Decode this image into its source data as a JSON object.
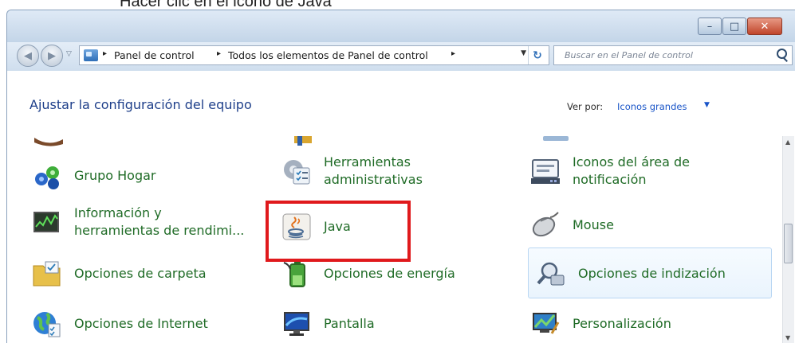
{
  "caption": "Hacer clic en el icono de Java",
  "window": {
    "controls": {
      "minimize": "–",
      "maximize": "□",
      "close": "✕"
    }
  },
  "navigation": {
    "back_icon": "◀",
    "forward_icon": "▶",
    "history_icon": "▽",
    "breadcrumb": [
      "Panel de control",
      "Todos los elementos de Panel de control"
    ],
    "separator": "▸",
    "dropdown_icon": "▼",
    "refresh_icon": "↻",
    "search_placeholder": "Buscar en el Panel de control"
  },
  "page": {
    "heading": "Ajustar la configuración del equipo",
    "view_by_label": "Ver por:",
    "view_by_value": "Iconos grandes",
    "view_by_arrow": "▼"
  },
  "items": [
    {
      "id": "grupo-hogar",
      "lines": [
        "Grupo Hogar"
      ],
      "icon": "homegroup-icon"
    },
    {
      "id": "herramientas-administrativas",
      "lines": [
        "Herramientas",
        "administrativas"
      ],
      "icon": "admin-tools-icon"
    },
    {
      "id": "iconos-area-notificacion",
      "lines": [
        "Iconos del área de",
        "notificación"
      ],
      "icon": "notification-area-icon"
    },
    {
      "id": "informacion-rendimiento",
      "lines": [
        "Información y",
        "herramientas de rendimi..."
      ],
      "icon": "performance-icon"
    },
    {
      "id": "java",
      "lines": [
        "Java"
      ],
      "icon": "java-icon",
      "highlighted": true
    },
    {
      "id": "mouse",
      "lines": [
        "Mouse"
      ],
      "icon": "mouse-icon"
    },
    {
      "id": "opciones-carpeta",
      "lines": [
        "Opciones de carpeta"
      ],
      "icon": "folder-options-icon"
    },
    {
      "id": "opciones-energia",
      "lines": [
        "Opciones de energía"
      ],
      "icon": "power-options-icon"
    },
    {
      "id": "opciones-indizacion",
      "lines": [
        "Opciones de indización"
      ],
      "icon": "indexing-options-icon",
      "hovered": true
    },
    {
      "id": "opciones-internet",
      "lines": [
        "Opciones de Internet"
      ],
      "icon": "internet-options-icon"
    },
    {
      "id": "pantalla",
      "lines": [
        "Pantalla"
      ],
      "icon": "display-icon"
    },
    {
      "id": "personalizacion",
      "lines": [
        "Personalización"
      ],
      "icon": "personalization-icon"
    }
  ],
  "colors": {
    "item_text": "#1f6b26",
    "heading": "#1e3f8a",
    "link": "#1a55c8",
    "highlight_box": "#e0191c"
  }
}
